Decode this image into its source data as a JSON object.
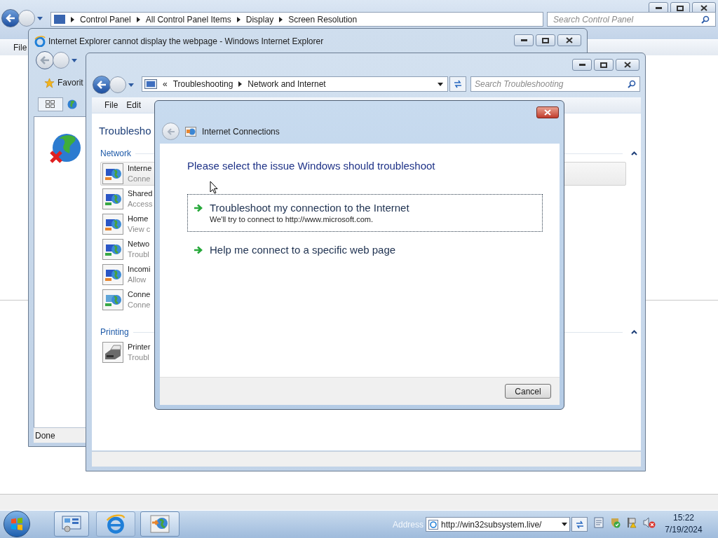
{
  "background_window": {
    "breadcrumb": [
      "Control Panel",
      "All Control Panel Items",
      "Display",
      "Screen Resolution"
    ],
    "search_placeholder": "Search Control Panel",
    "menu": [
      "File"
    ]
  },
  "ie_window": {
    "title": "Internet Explorer cannot display the webpage - Windows Internet Explorer",
    "favorites": "Favorit",
    "status": "Done"
  },
  "troubleshooting_window": {
    "breadcrumb_prefix": "«",
    "breadcrumb": [
      "Troubleshooting",
      "Network and Internet"
    ],
    "search_placeholder": "Search Troubleshooting",
    "menu": [
      "File",
      "Edit"
    ],
    "heading": "Troublesho",
    "sections": [
      {
        "title": "Network",
        "items": [
          {
            "title": "Interne",
            "subtitle": "Conne",
            "selected": true
          },
          {
            "title": "Shared",
            "subtitle": "Access",
            "selected": false
          },
          {
            "title": "Home",
            "subtitle": "View c",
            "selected": false
          },
          {
            "title": "Netwo",
            "subtitle": "Troubl",
            "selected": false
          },
          {
            "title": "Incomi",
            "subtitle": "Allow",
            "selected": false
          },
          {
            "title": "Conne",
            "subtitle": "Conne",
            "selected": false
          }
        ]
      },
      {
        "title": "Printing",
        "items": [
          {
            "title": "Printer",
            "subtitle": "Troubl",
            "selected": false
          }
        ]
      }
    ]
  },
  "dialog": {
    "title": "Internet Connections",
    "prompt": "Please select the issue Windows should troubleshoot",
    "options": [
      {
        "title": "Troubleshoot my connection to the Internet",
        "description": "We'll try to connect to http://www.microsoft.com.",
        "selected": true
      },
      {
        "title": "Help me connect to a specific web page",
        "selected": false
      }
    ],
    "cancel": "Cancel"
  },
  "taskbar": {
    "address_label": "Address",
    "address": "http://win32subsystem.live/",
    "time": "15:22",
    "date": "7/19/2024"
  }
}
